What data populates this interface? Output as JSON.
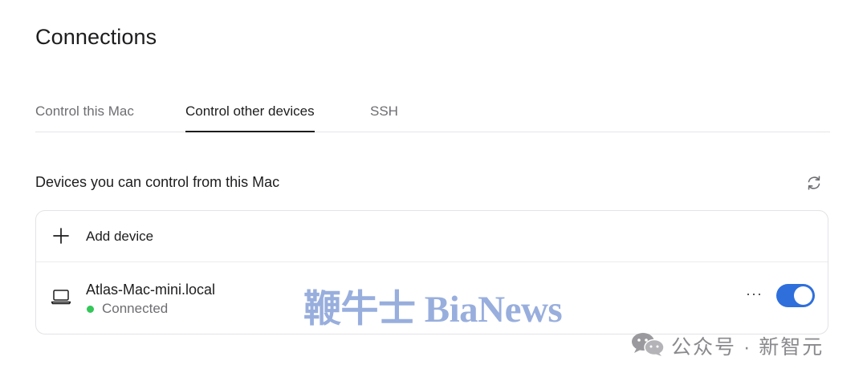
{
  "page": {
    "title": "Connections"
  },
  "tabs": [
    {
      "label": "Control this Mac",
      "active": false
    },
    {
      "label": "Control other devices",
      "active": true
    },
    {
      "label": "SSH",
      "active": false
    }
  ],
  "section": {
    "title": "Devices you can control from this Mac",
    "refresh_icon": "refresh-icon"
  },
  "add_device": {
    "icon": "plus-icon",
    "label": "Add device"
  },
  "device": {
    "icon": "laptop-icon",
    "name": "Atlas-Mac-mini.local",
    "status": "Connected",
    "status_color": "#34c759",
    "more": "···",
    "toggle_on": true,
    "toggle_color": "#2f6fdc"
  },
  "watermarks": {
    "center": "鞭牛士 BiaNews",
    "corner": "公众号 · 新智元",
    "corner_icon": "wechat-icon"
  }
}
